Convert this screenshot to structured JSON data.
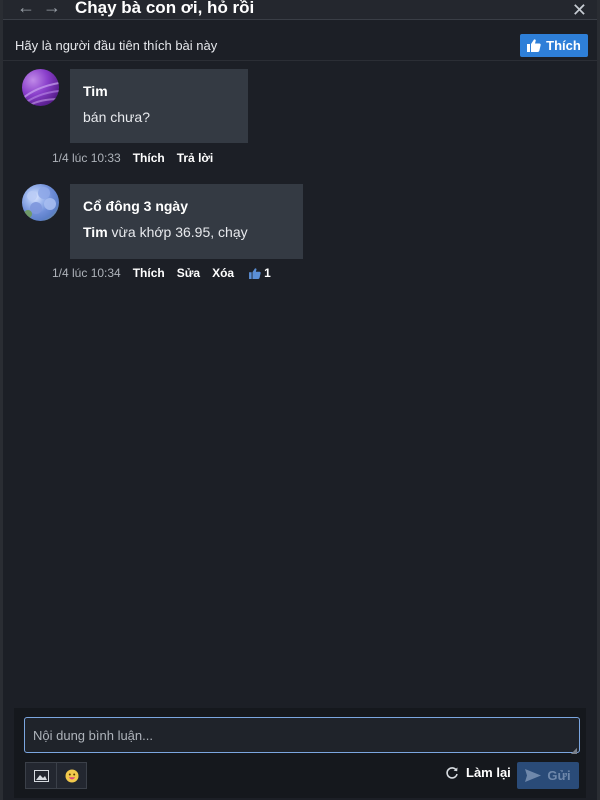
{
  "header": {
    "title": "Chạy bà con ơi, hỏ rồi",
    "back_icon": "arrow-left-icon",
    "forward_icon": "arrow-right-icon",
    "close_icon": "close-icon"
  },
  "like_bar": {
    "prompt": "Hãy là người đầu tiên thích bài này",
    "button_label": "Thích",
    "button_color": "#2e7fd8"
  },
  "comments": [
    {
      "author": "Tim",
      "text": "bán chưa?",
      "time": "1/4 lúc 10:33",
      "actions": [
        "Thích",
        "Trả lời"
      ]
    },
    {
      "author": "Cổ đông 3 ngày",
      "mention": "Tim",
      "text": " vừa khớp 36.95, chạy",
      "time": "1/4 lúc 10:34",
      "actions": [
        "Thích",
        "Sửa",
        "Xóa"
      ],
      "like_count": "1"
    }
  ],
  "composer": {
    "placeholder": "Nội dung bình luận...",
    "image_icon": "image-icon",
    "emoji_icon": "emoji-icon",
    "reload_label": "Làm lại",
    "send_label": "Gửi"
  }
}
